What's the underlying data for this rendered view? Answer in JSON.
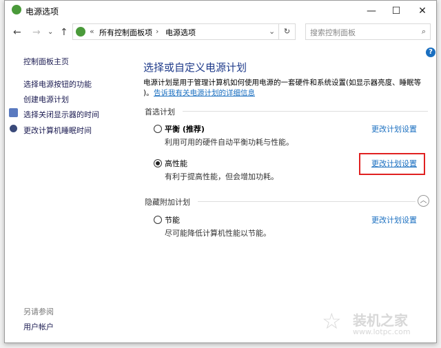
{
  "window": {
    "title": "电源选项",
    "minimize": "—",
    "maximize": "☐",
    "close": "✕"
  },
  "nav": {
    "back": "←",
    "forward": "→",
    "recent": "⌄",
    "up": "↑",
    "breadcrumb": [
      "所有控制面板项",
      "电源选项"
    ],
    "breadcrumb_prefix": "«",
    "separator": "›",
    "dropdown": "⌄",
    "refresh": "↻",
    "search_placeholder": "搜索控制面板",
    "search_icon": "⌕"
  },
  "sidebar": {
    "home": "控制面板主页",
    "items": [
      "选择电源按钮的功能",
      "创建电源计划",
      "选择关闭显示器的时间",
      "更改计算机睡眠时间"
    ],
    "see_also": "另请参阅",
    "see_also_items": [
      "用户帐户"
    ]
  },
  "main": {
    "heading": "选择或自定义电源计划",
    "intro": "电源计划是用于管理计算机如何使用电源的一套硬件和系统设置(如显示器亮度、睡眠等",
    "intro2": ")。",
    "intro_link": "告诉我有关电源计划的详细信息",
    "preferred_label": "首选计划",
    "hidden_label": "隐藏附加计划",
    "plans": [
      {
        "name": "平衡 (推荐)",
        "desc": "利用可用的硬件自动平衡功耗与性能。",
        "link": "更改计划设置",
        "selected": false
      },
      {
        "name": "高性能",
        "desc": "有利于提高性能，但会增加功耗。",
        "link": "更改计划设置",
        "selected": true
      },
      {
        "name": "节能",
        "desc": "尽可能降低计算机性能以节能。",
        "link": "更改计划设置",
        "selected": false
      }
    ],
    "help": "?"
  },
  "watermark": {
    "name": "装机之家",
    "url": "www.lotpc.com"
  },
  "colors": {
    "link": "#1a6fc0",
    "highlight": "#e02020"
  }
}
